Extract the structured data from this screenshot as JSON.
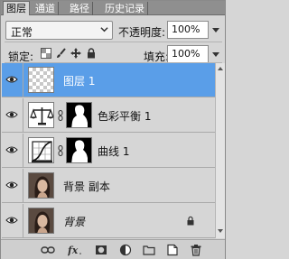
{
  "tabs": [
    {
      "label": "图层"
    },
    {
      "label": "通道"
    },
    {
      "label": "路径"
    },
    {
      "label": "历史记录"
    }
  ],
  "blend_mode": {
    "value": "正常"
  },
  "opacity": {
    "label": "不透明度:",
    "value": "100%"
  },
  "lock": {
    "label": "锁定:"
  },
  "fill": {
    "label": "填充:",
    "value": "100%"
  },
  "layers": [
    {
      "name": "图层 1"
    },
    {
      "name": "色彩平衡 1"
    },
    {
      "name": "曲线 1"
    },
    {
      "name": "背景 副本"
    },
    {
      "name": "背景"
    }
  ],
  "colors": {
    "selection": "#5a9ee8",
    "panel": "#d6d6d6"
  }
}
